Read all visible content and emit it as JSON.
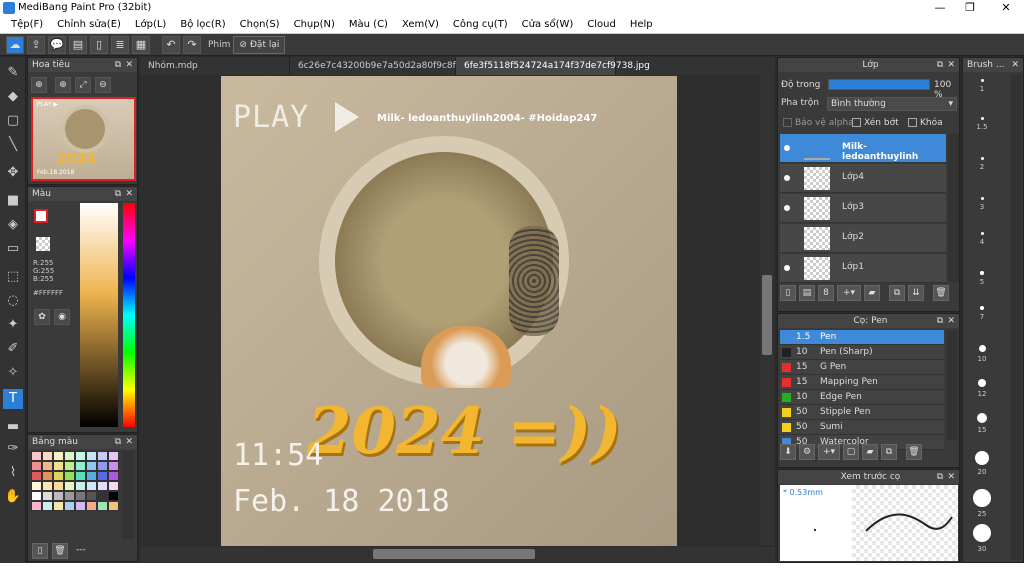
{
  "window": {
    "title": "MediBang Paint Pro (32bit)",
    "min": "—",
    "max": "❐",
    "close": "✕"
  },
  "menu": [
    "Tệp(F)",
    "Chỉnh sửa(E)",
    "Lớp(L)",
    "Bộ lọc(R)",
    "Chọn(S)",
    "Chụp(N)",
    "Màu (C)",
    "Xem(V)",
    "Công cụ(T)",
    "Cửa sổ(W)",
    "Cloud",
    "Help"
  ],
  "toolbar": {
    "shortcut_label": "Phím",
    "reset_label": "Đặt lại"
  },
  "navigator": {
    "title": "Hoa tiêu",
    "thumb_play": "PLAY ▶",
    "thumb_year": "2024",
    "thumb_date": "Feb.18.2018"
  },
  "color": {
    "title": "Màu",
    "r": "R:255",
    "g": "G:255",
    "b": "B:255",
    "hex": "#FFFFFF"
  },
  "palette": {
    "title": "Bảng màu",
    "footer": "---",
    "swatches": [
      "#f7c6c6",
      "#f7d9c6",
      "#f7f0c6",
      "#d9f7c6",
      "#c6f7e6",
      "#c6e2f7",
      "#c6ccf7",
      "#e4c6f7",
      "#ef8f8f",
      "#efb88f",
      "#efe28f",
      "#b8ef8f",
      "#8fefd0",
      "#8fc7ef",
      "#8f9bef",
      "#c98fef",
      "#e05a5a",
      "#e0935a",
      "#e0d35a",
      "#93e05a",
      "#5ae0b6",
      "#5aa9e0",
      "#5a6ae0",
      "#ad5ae0",
      "#fff4d6",
      "#ffe7b3",
      "#fcd9a0",
      "#e6f5c4",
      "#c9f2ec",
      "#d3e6fb",
      "#e3dcfa",
      "#f6dbef",
      "#ffffff",
      "#dddddd",
      "#bbbbbb",
      "#999999",
      "#777777",
      "#555555",
      "#333333",
      "#000000",
      "#f6b6cc",
      "#c7f0f2",
      "#f5e6a8",
      "#a8d0f5",
      "#d3b8f3",
      "#f7a98c",
      "#9fe3b4",
      "#f4c27a"
    ]
  },
  "tabs": [
    "Nhóm.mdp",
    "6c26e7c43200b9e7a50d2a80f9c8f26d.jpg",
    "6fe3f5118f524724a174f37de7cf9738.jpg"
  ],
  "canvas": {
    "play": "PLAY",
    "credit": "Milk- ledoanthuylinh2004- #Hoidap247",
    "year": "2024 =))",
    "time": "11:54",
    "date": "Feb. 18 2018"
  },
  "layers": {
    "title": "Lớp",
    "opacity_label": "Độ trong",
    "opacity_value": "100 %",
    "opacity": 1.0,
    "blend_label": "Pha trộn",
    "blend_value": "Bình thường",
    "alpha_label": "Bảo vệ alpha",
    "clip_label": "Xén bớt",
    "lock_label": "Khóa",
    "items": [
      {
        "name": "Milk- ledoanthuylinh",
        "selected": true,
        "visible": true
      },
      {
        "name": "Lớp4",
        "selected": false,
        "visible": true
      },
      {
        "name": "Lớp3",
        "selected": false,
        "visible": true
      },
      {
        "name": "Lớp2",
        "selected": false,
        "visible": false
      },
      {
        "name": "Lớp1",
        "selected": false,
        "visible": true
      }
    ]
  },
  "brushes": {
    "title": "Cọ: Pen",
    "items": [
      {
        "size": "1.5",
        "name": "Pen",
        "color": "#3f8ad8",
        "selected": true
      },
      {
        "size": "10",
        "name": "Pen (Sharp)",
        "color": "#222222",
        "selected": false
      },
      {
        "size": "15",
        "name": "G Pen",
        "color": "#e03030",
        "selected": false
      },
      {
        "size": "15",
        "name": "Mapping Pen",
        "color": "#e03030",
        "selected": false
      },
      {
        "size": "10",
        "name": "Edge Pen",
        "color": "#20b020",
        "selected": false
      },
      {
        "size": "50",
        "name": "Stipple Pen",
        "color": "#f0d020",
        "selected": false
      },
      {
        "size": "50",
        "name": "Sumi",
        "color": "#f0d020",
        "selected": false
      },
      {
        "size": "50",
        "name": "Watercolor",
        "color": "#3f8ad8",
        "selected": false
      }
    ]
  },
  "preview": {
    "title": "Xem trước cọ",
    "size_text": "* 0.53mm"
  },
  "brushsize": {
    "title": "Brush ...",
    "sizes": [
      "1",
      "1.5",
      "2",
      "3",
      "4",
      "5",
      "7",
      "10",
      "12",
      "15",
      "20",
      "25",
      "30"
    ]
  }
}
